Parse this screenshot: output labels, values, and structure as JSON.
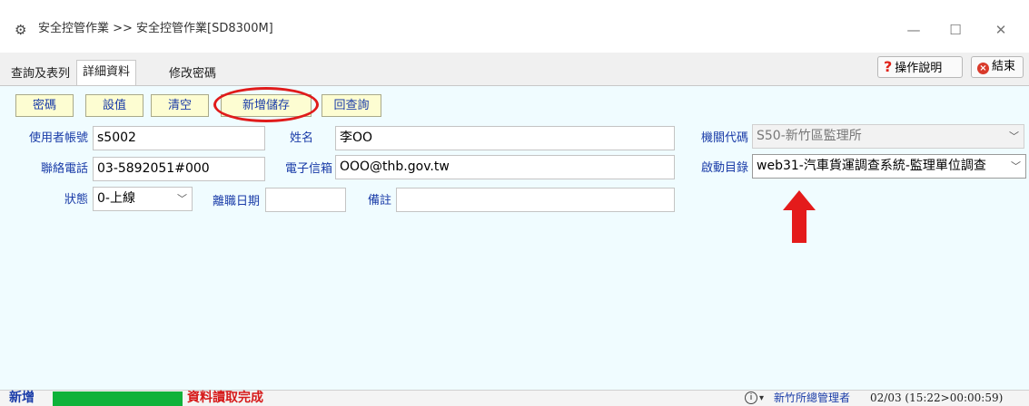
{
  "window": {
    "title": "安全控管作業 >> 安全控管作業[SD8300M]",
    "minimize": "—",
    "maximize": "☐",
    "close": "✕"
  },
  "tabs": {
    "query": "查詢及表列",
    "detail": "詳細資料",
    "password": "修改密碼"
  },
  "top_buttons": {
    "help_icon": "?",
    "help": "操作說明",
    "exit_icon": "×",
    "exit": "結束"
  },
  "actions": {
    "password": "密碼",
    "set_value": "設值",
    "clear": "清空",
    "save_new": "新增儲存",
    "back_query": "回查詢"
  },
  "form": {
    "account_label": "使用者帳號",
    "account_value": "s5002",
    "name_label": "姓名",
    "name_value": "李OO",
    "agency_label": "機關代碼",
    "agency_value": "S50-新竹區監理所",
    "phone_label": "聯絡電話",
    "phone_value": "03-5892051#000",
    "email_label": "電子信箱",
    "email_value": "OOO@thb.gov.tw",
    "start_menu_label": "啟動目錄",
    "start_menu_value": "web31-汽車貨運調查系統-監理單位調查",
    "status_label": "狀態",
    "status_value": "0-上線",
    "leave_date_label": "離職日期",
    "leave_date_value": "",
    "remark_label": "備註",
    "remark_value": ""
  },
  "statusbar": {
    "mode": "新增",
    "progress": 1.0,
    "message": "資料讀取完成",
    "user_icon": "i",
    "user": "新竹所總管理者",
    "time": "02/03 (15:22>00:00:59)"
  },
  "colors": {
    "pane_bg": "#f0fcff",
    "button_bg": "#fdfdd2",
    "label_blue": "#1a3ca8",
    "highlight_red": "#e01b1b",
    "progress_green": "#0fb23a"
  },
  "icons": {
    "app": "gear-app-icon",
    "help": "question-icon",
    "exit": "close-circle-icon",
    "dropdown": "chevron-down-icon",
    "annotation": "red-arrow-up"
  }
}
